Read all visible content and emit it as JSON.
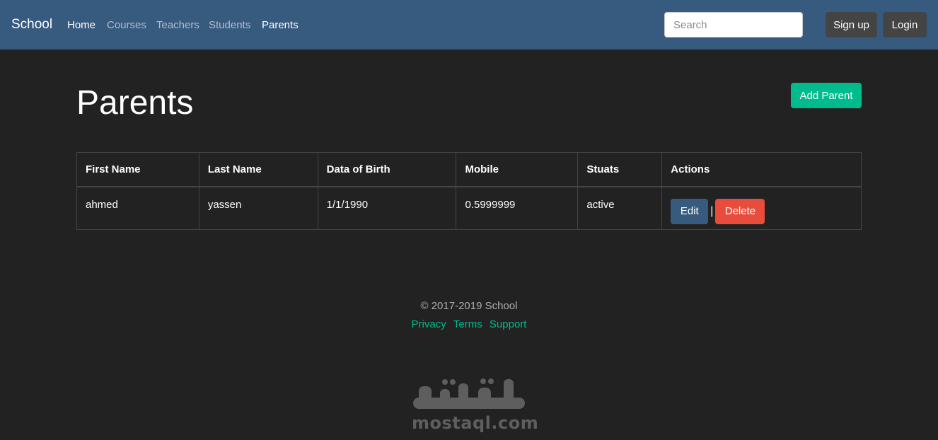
{
  "nav": {
    "brand": "School",
    "links": [
      {
        "label": "Home"
      },
      {
        "label": "Courses"
      },
      {
        "label": "Teachers"
      },
      {
        "label": "Students"
      },
      {
        "label": "Parents"
      }
    ],
    "search_placeholder": "Search",
    "signup_label": "Sign up",
    "login_label": "Login"
  },
  "page": {
    "title": "Parents",
    "add_label": "Add Parent"
  },
  "table": {
    "headers": [
      "First Name",
      "Last Name",
      "Data of Birth",
      "Mobile",
      "Stuats",
      "Actions"
    ],
    "rows": [
      {
        "first_name": "ahmed",
        "last_name": "yassen",
        "dob": "1/1/1990",
        "mobile": "0.5999999",
        "status": "active",
        "edit_label": "Edit",
        "separator": "|",
        "delete_label": "Delete"
      }
    ]
  },
  "footer": {
    "copyright": "© 2017-2019 School",
    "links": [
      {
        "label": "Privacy"
      },
      {
        "label": "Terms"
      },
      {
        "label": "Support"
      }
    ]
  },
  "watermark": {
    "logo_text": "مستقل",
    "domain": "mostaql.com"
  },
  "colors": {
    "navbar": "#375a7f",
    "background": "#222222",
    "accent_green": "#00bc8c",
    "danger": "#e74c3c",
    "dark_button": "#444444"
  }
}
